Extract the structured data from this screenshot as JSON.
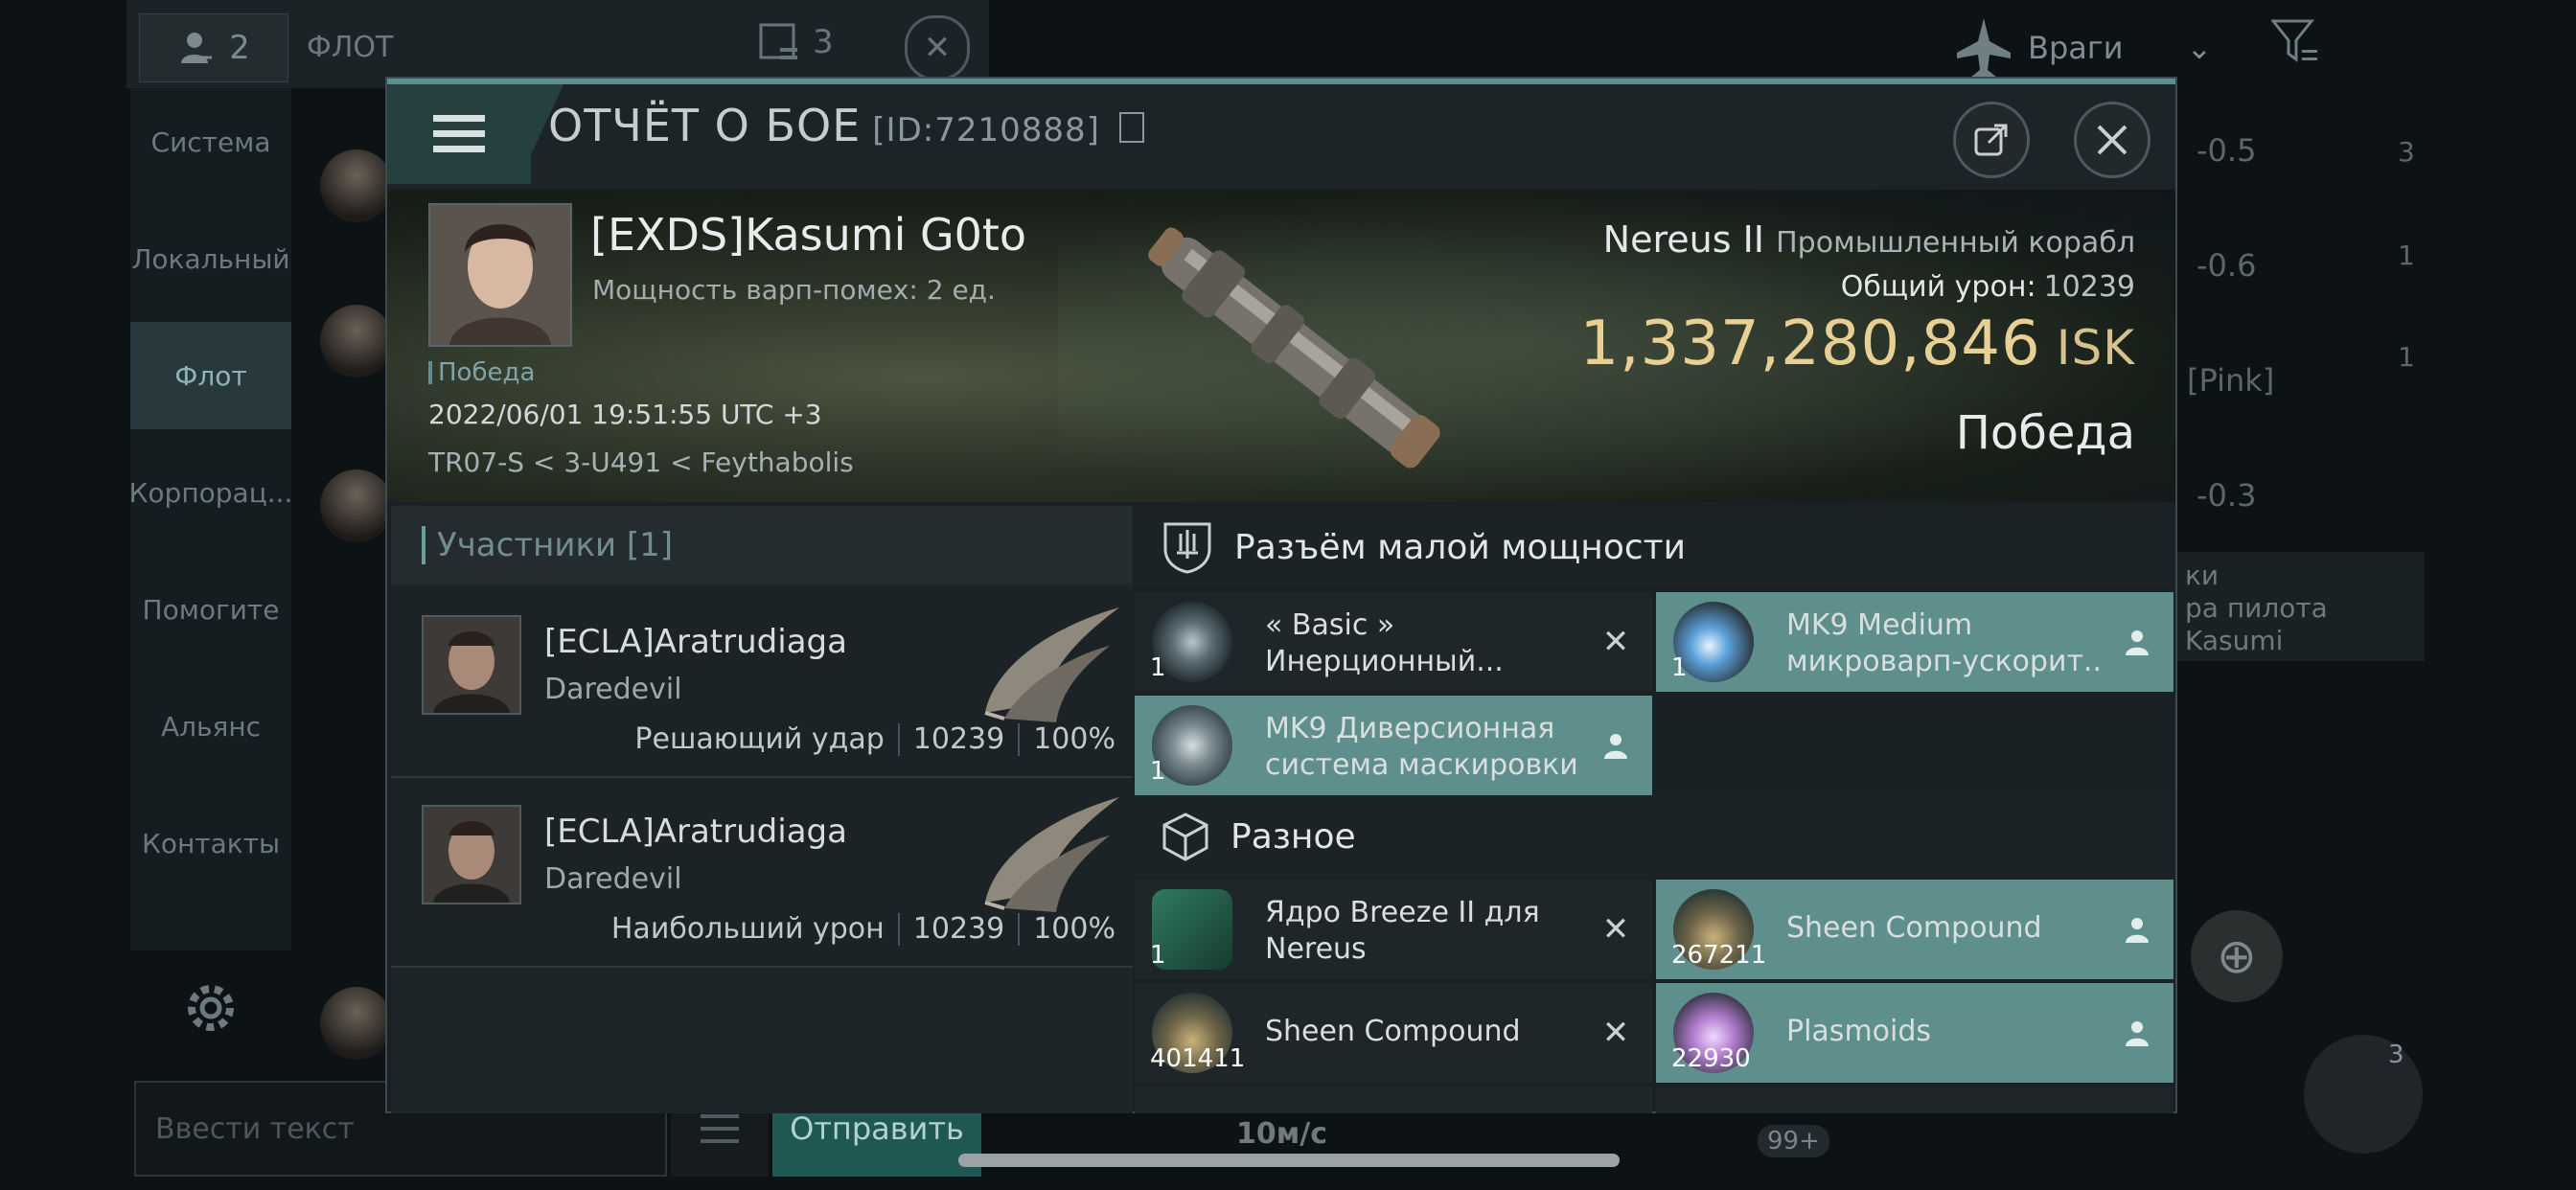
{
  "background": {
    "topbar": {
      "member_count": "2",
      "fleet_label": "ФЛОТ",
      "count3": "3"
    },
    "sidebar_tabs": [
      "Система",
      "Локальный",
      "Флот",
      "Корпорац...",
      "Помогите",
      "Альянс",
      "Контакты"
    ],
    "active_tab": "Флот",
    "chat_input_placeholder": "Ввести текст",
    "send_label": "Отправить",
    "enemy_filter": "Враги",
    "side_values": [
      "-0.5",
      "-0.6",
      "[Pink]",
      "-0.3"
    ],
    "side_badges": [
      "3",
      "1",
      "1"
    ],
    "side_text": [
      "ки",
      "ра пилота",
      "Kasumi"
    ],
    "speed": "10м/с",
    "badge_99": "99+",
    "badge_3": "3"
  },
  "modal": {
    "title": "ОТЧЁТ О БОЕ",
    "report_id": "[ID:7210888]",
    "victim": {
      "name": "[EXDS]Kasumi G0to",
      "warp_strength": "Мощность варп-помех: 2 ед.",
      "tag": "Победа",
      "datetime": "2022/06/01 19:51:55 UTC +3",
      "location": "TR07-S < 3-U491 < Feythabolis"
    },
    "ship": {
      "name": "Nereus II",
      "class": "Промышленный корабл",
      "damage_label": "Общий урон:",
      "damage_value": "10239",
      "isk_value": "1,337,280,846",
      "isk_unit": "ISK",
      "outcome": "Победа"
    },
    "participants": {
      "header": "Участники [1]",
      "items": [
        {
          "name": "[ECLA]Aratrudiaga",
          "ship": "Daredevil",
          "role": "Решающий удар",
          "damage": "10239",
          "percent": "100%"
        },
        {
          "name": "[ECLA]Aratrudiaga",
          "ship": "Daredevil",
          "role": "Наибольший урон",
          "damage": "10239",
          "percent": "100%"
        }
      ]
    },
    "sections": [
      {
        "title": "Разъём малой мощности",
        "items": [
          {
            "name": "« Basic » Инерционный...",
            "qty": "1",
            "state": "destroyed"
          },
          {
            "name": "MK9 Medium микроварп-ускорит....",
            "qty": "1",
            "state": "dropped"
          },
          {
            "name": "MK9 Диверсионная система маскировки",
            "qty": "1",
            "state": "dropped"
          }
        ]
      },
      {
        "title": "Разное",
        "items": [
          {
            "name": "Ядро Breeze II для Nereus",
            "qty": "1",
            "state": "destroyed"
          },
          {
            "name": "Sheen Compound",
            "qty": "267211",
            "state": "dropped"
          },
          {
            "name": "Sheen Compound",
            "qty": "401411",
            "state": "destroyed"
          },
          {
            "name": "Plasmoids",
            "qty": "22930",
            "state": "dropped"
          }
        ]
      }
    ]
  }
}
